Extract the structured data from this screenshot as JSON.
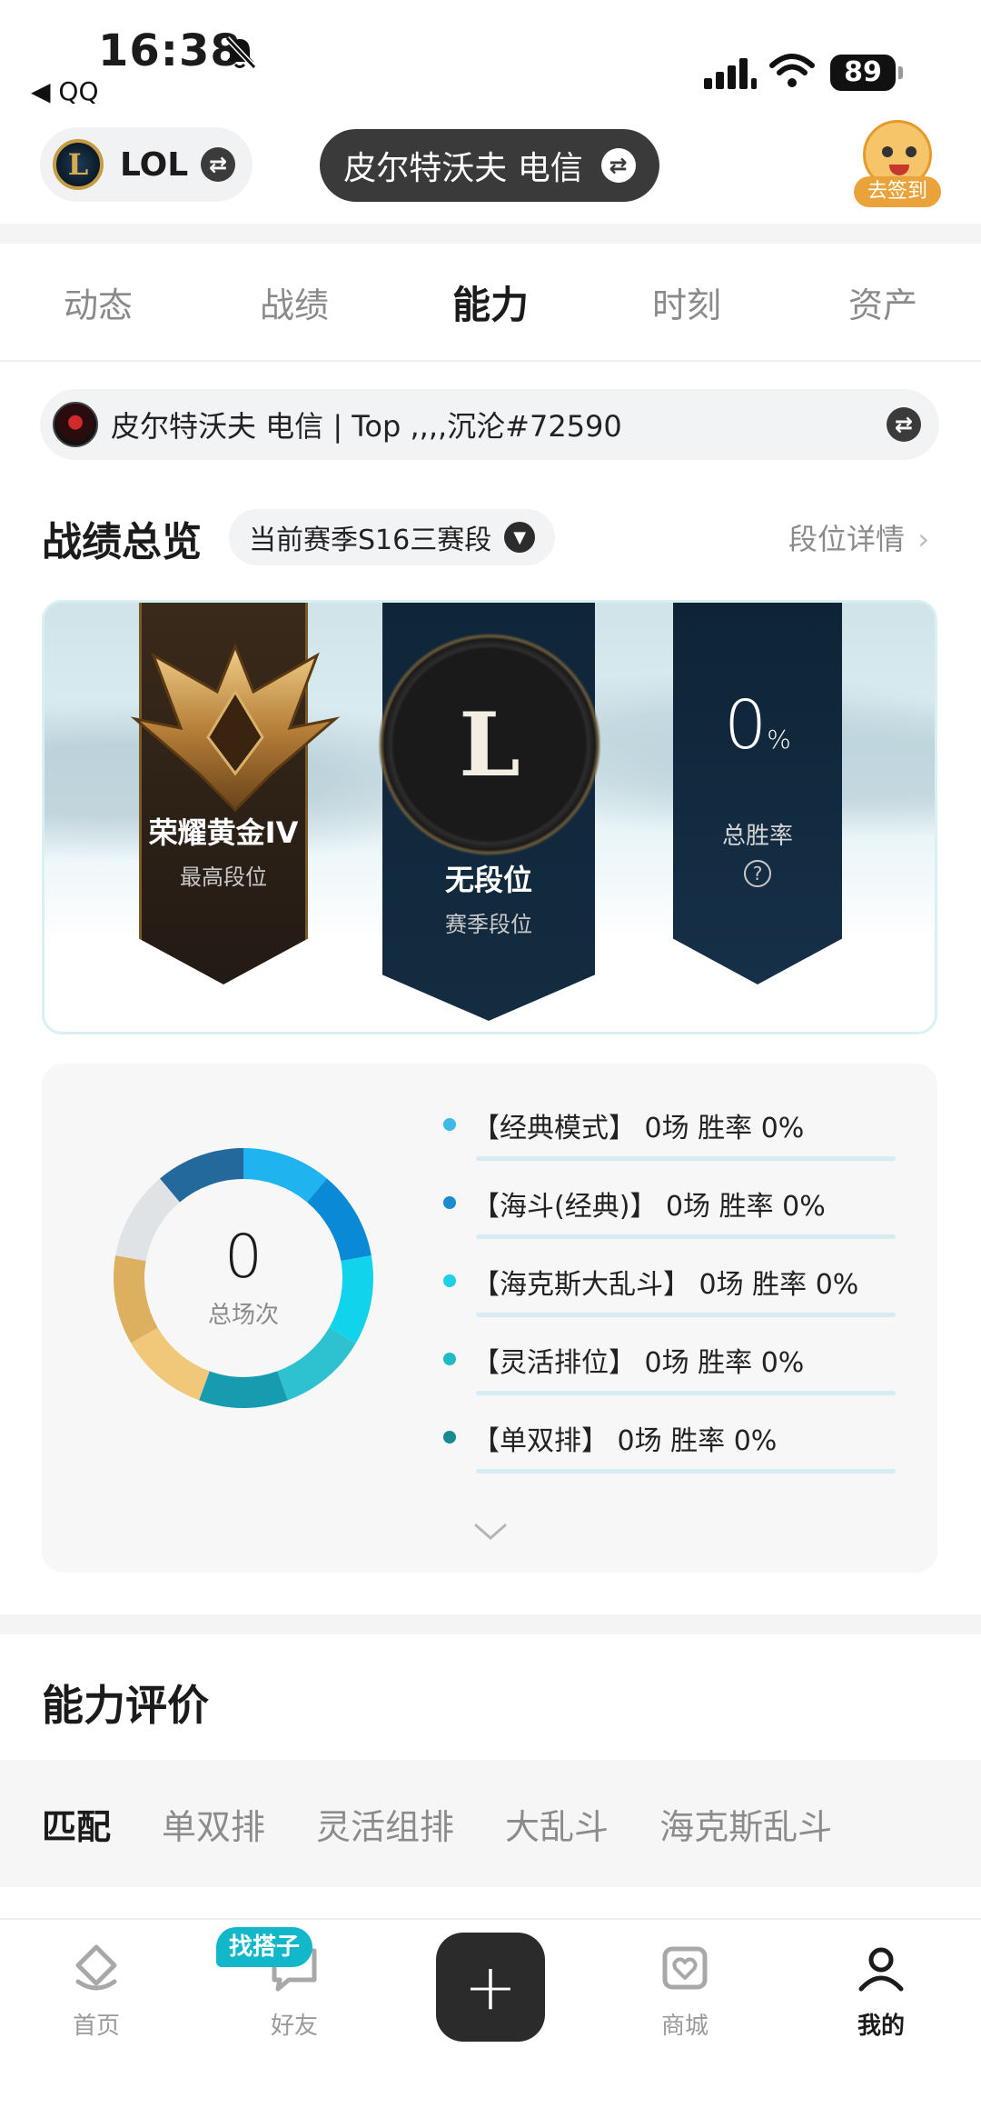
{
  "status_bar": {
    "time": "16:38",
    "back_app": "◀ QQ",
    "battery": "89"
  },
  "header": {
    "game_label": "LOL",
    "logo_letter": "L",
    "server": "皮尔特沃夫 电信",
    "checkin_label": "去签到"
  },
  "tabs": [
    {
      "label": "动态"
    },
    {
      "label": "战绩"
    },
    {
      "label": "能力"
    },
    {
      "label": "时刻"
    },
    {
      "label": "资产"
    }
  ],
  "account": {
    "text": "皮尔特沃夫 电信 | Top ,,,,沉沦#72590"
  },
  "overview": {
    "title": "战绩总览",
    "season": "当前赛季S16三赛段",
    "rank_detail": "段位详情",
    "chevron_right": "›",
    "highest_rank": {
      "name": "荣耀黄金IV",
      "label": "最高段位"
    },
    "season_rank": {
      "name": "无段位",
      "label": "赛季段位",
      "emblem_letter": "L"
    },
    "win_rate": {
      "value": "0",
      "unit": "%",
      "label": "总胜率",
      "help": "?"
    }
  },
  "modes": {
    "total_value": "0",
    "total_label": "总场次",
    "items": [
      {
        "text": "【经典模式】 0场  胜率 0%",
        "color": "#3dbbe8"
      },
      {
        "text": "【海斗(经典)】 0场  胜率 0%",
        "color": "#1a8ccf"
      },
      {
        "text": "【海克斯大乱斗】 0场  胜率 0%",
        "color": "#1fd0e6"
      },
      {
        "text": "【灵活排位】 0场  胜率 0%",
        "color": "#22b9c6"
      },
      {
        "text": "【单双排】 0场  胜率 0%",
        "color": "#178a92"
      }
    ],
    "donut_colors": [
      "#1fb4ef",
      "#0a8ad6",
      "#11d4ec",
      "#2ec1cf",
      "#169cae",
      "#f1c779",
      "#dcb05f",
      "#dfe3e6",
      "#23699c"
    ]
  },
  "ability": {
    "title": "能力评价",
    "tabs": [
      {
        "label": "匹配"
      },
      {
        "label": "单双排"
      },
      {
        "label": "灵活组排"
      },
      {
        "label": "大乱斗"
      },
      {
        "label": "海克斯乱斗"
      }
    ]
  },
  "bottom_nav": {
    "items": [
      {
        "label": "首页"
      },
      {
        "label": "好友"
      },
      {
        "label": "商城"
      },
      {
        "label": "我的"
      }
    ],
    "friend_tag": "找搭子",
    "add_symbol": "+"
  }
}
